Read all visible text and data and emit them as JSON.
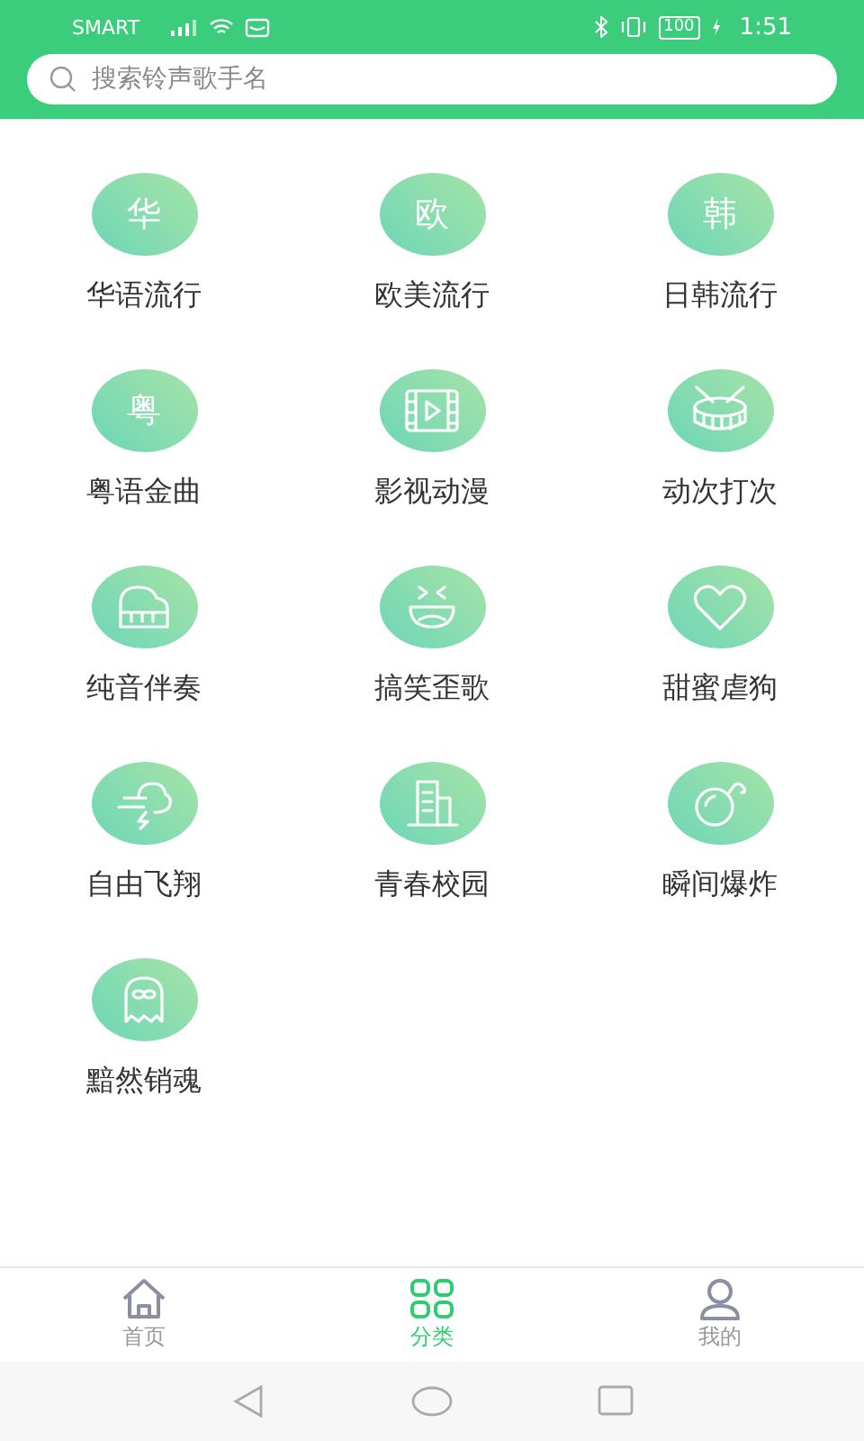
{
  "status_bar": {
    "carrier": "SMART",
    "battery": "100",
    "time": "1:51"
  },
  "search": {
    "placeholder": "搜索铃声歌手名"
  },
  "categories": [
    {
      "kind": "glyph",
      "glyph": "华",
      "label": "华语流行"
    },
    {
      "kind": "glyph",
      "glyph": "欧",
      "label": "欧美流行"
    },
    {
      "kind": "glyph",
      "glyph": "韩",
      "label": "日韩流行"
    },
    {
      "kind": "glyph",
      "glyph": "粤",
      "label": "粤语金曲"
    },
    {
      "kind": "icon",
      "label": "影视动漫"
    },
    {
      "kind": "icon",
      "label": "动次打次"
    },
    {
      "kind": "icon",
      "label": "纯音伴奏"
    },
    {
      "kind": "icon",
      "label": "搞笑歪歌"
    },
    {
      "kind": "icon",
      "label": "甜蜜虐狗"
    },
    {
      "kind": "icon",
      "label": "自由飞翔"
    },
    {
      "kind": "icon",
      "label": "青春校园"
    },
    {
      "kind": "icon",
      "label": "瞬间爆炸"
    },
    {
      "kind": "icon",
      "label": "黯然销魂"
    }
  ],
  "tabs": [
    {
      "label": "首页",
      "selected": false
    },
    {
      "label": "分类",
      "selected": true
    },
    {
      "label": "我的",
      "selected": false
    }
  ]
}
